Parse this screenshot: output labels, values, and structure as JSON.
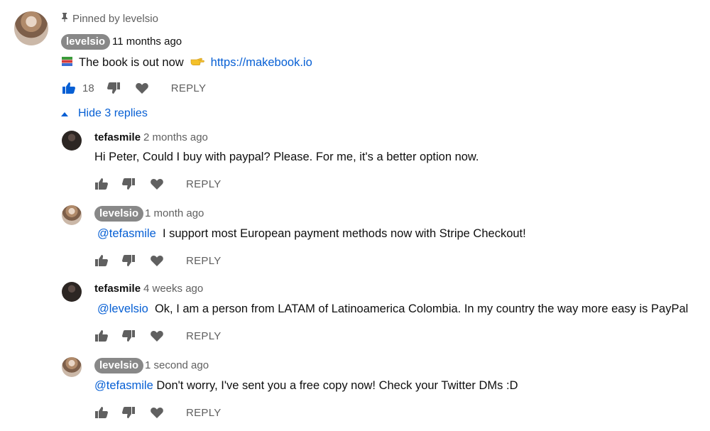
{
  "pinned": {
    "pin_label": "Pinned by levelsio",
    "author": "levelsio",
    "time": "11 months ago",
    "text_prefix": "The book is out now",
    "link": "https://makebook.io",
    "likes": "18",
    "reply_label": "REPLY"
  },
  "replies_toggle": "Hide 3 replies",
  "replies": [
    {
      "author": "tefasmile",
      "time": "2 months ago",
      "mention": "",
      "text": "Hi Peter, Could I buy with paypal? Please. For me, it's a better option now.",
      "reply_label": "REPLY"
    },
    {
      "author": "levelsio",
      "time": "1 month ago",
      "mention": "@tefasmile",
      "text": "I support most European payment methods now with Stripe Checkout!",
      "reply_label": "REPLY"
    },
    {
      "author": "tefasmile",
      "time": "4 weeks ago",
      "mention": "@levelsio",
      "text": "Ok, I am a person from LATAM of Latinoamerica Colombia. In my country the way more easy is PayPal",
      "reply_label": "REPLY"
    },
    {
      "author": "levelsio",
      "time": "1 second ago",
      "mention": "@tefasmile",
      "text": "Don't worry, I've sent you a free copy now! Check your Twitter DMs :D",
      "reply_label": "REPLY"
    }
  ],
  "colors": {
    "link": "#065fd4",
    "secondary_text": "#606060",
    "badge_bg": "#888888"
  }
}
